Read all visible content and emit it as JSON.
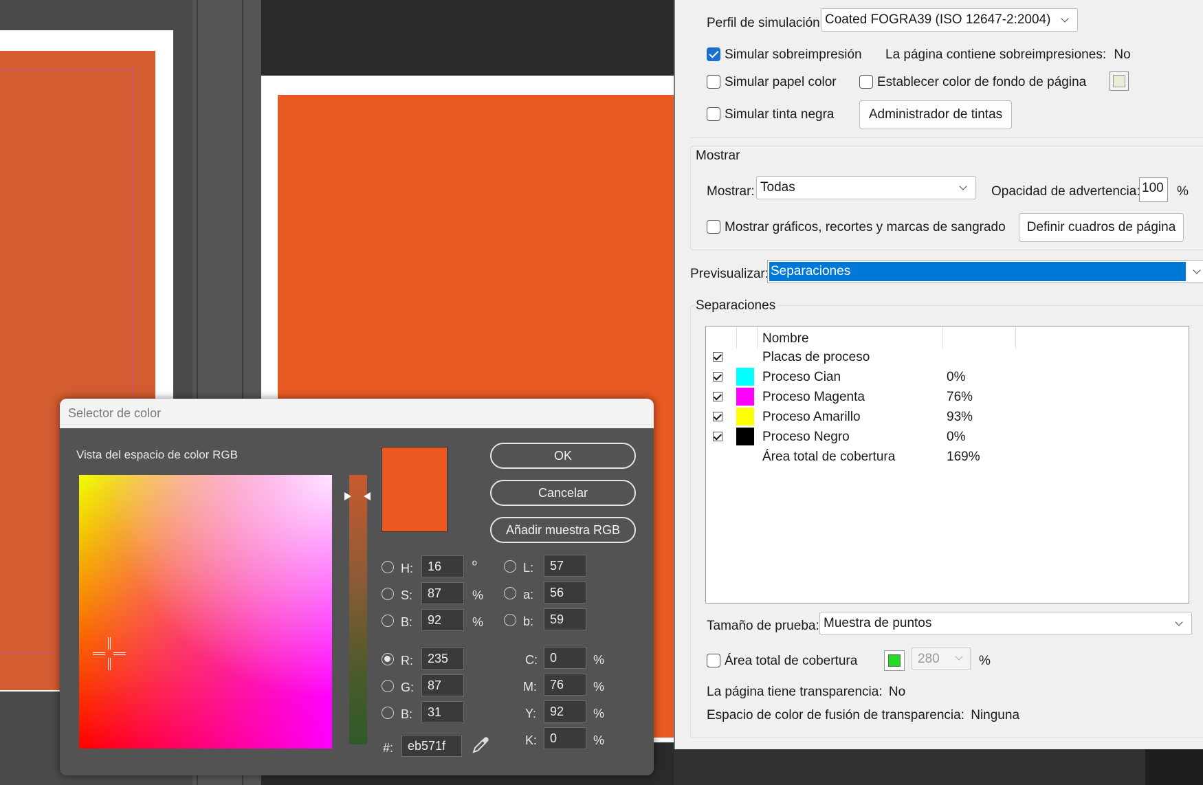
{
  "panel": {
    "perfil_label": "Perfil de simulación:",
    "perfil_value": "Coated FOGRA39 (ISO 12647-2:2004)",
    "simular_sobreimpresion": "Simular sobreimpresión",
    "pagina_sobreimpresiones": "La página contiene sobreimpresiones:",
    "pagina_sobreimpresiones_value": "No",
    "simular_papel": "Simular papel color",
    "establecer_fondo": "Establecer color de fondo de página",
    "simular_tinta": "Simular tinta negra",
    "admin_tintas": "Administrador de tintas",
    "mostrar_group": "Mostrar",
    "mostrar_label": "Mostrar:",
    "mostrar_value": "Todas",
    "opacidad_label": "Opacidad de advertencia:",
    "opacidad_value": "100",
    "opacidad_unit": "%",
    "mostrar_graficos": "Mostrar gráficos, recortes y marcas de sangrado",
    "definir_cuadros": "Definir cuadros de página",
    "previsualizar_label": "Previsualizar:",
    "previsualizar_value": "Separaciones",
    "separaciones_group": "Separaciones",
    "col_nombre": "Nombre",
    "rows": [
      {
        "name": "Placas de proceso",
        "value": "",
        "color": ""
      },
      {
        "name": "Proceso Cian",
        "value": "0%",
        "color": "#00ffff"
      },
      {
        "name": "Proceso Magenta",
        "value": "76%",
        "color": "#ff00ff"
      },
      {
        "name": "Proceso Amarillo",
        "value": "93%",
        "color": "#ffff00"
      },
      {
        "name": "Proceso Negro",
        "value": "0%",
        "color": "#000000"
      },
      {
        "name": "Área total de cobertura",
        "value": "169%",
        "color": ""
      }
    ],
    "tamano_label": "Tamaño de prueba:",
    "tamano_value": "Muestra de puntos",
    "area_total": "Área total de cobertura",
    "area_value": "280",
    "area_unit": "%",
    "transparencia": "La página tiene transparencia:",
    "transparencia_value": "No",
    "espacio_fusion": "Espacio de color de fusión de transparencia:",
    "espacio_fusion_value": "Ninguna"
  },
  "dialog": {
    "title": "Selector de color",
    "vista": "Vista del espacio de color RGB",
    "ok": "OK",
    "cancel": "Cancelar",
    "add_rgb": "Añadir muestra RGB",
    "h_label": "H:",
    "h_value": "16",
    "h_unit": "º",
    "s_label": "S:",
    "s_value": "87",
    "s_unit": "%",
    "b_label": "B:",
    "b_value": "92",
    "b_unit": "%",
    "r_label": "R:",
    "r_value": "235",
    "g_label": "G:",
    "g_value": "87",
    "bb_label": "B:",
    "bb_value": "31",
    "l_label": "L:",
    "l_value": "57",
    "a_label": "a:",
    "a_value": "56",
    "lb_label": "b:",
    "lb_value": "59",
    "c_label": "C:",
    "c_value": "0",
    "m_label": "M:",
    "m_value": "76",
    "y_label": "Y:",
    "y_value": "92",
    "k_label": "K:",
    "k_value": "0",
    "cmyk_unit": "%",
    "hex_label": "#:",
    "hex_value": "eb571f",
    "current_color": "#eb571f"
  },
  "colors": {
    "orange_doc": "#e85a23",
    "orange_dark": "#d35c30",
    "accent": "#0078d7",
    "area_swatch": "#22dd22"
  }
}
